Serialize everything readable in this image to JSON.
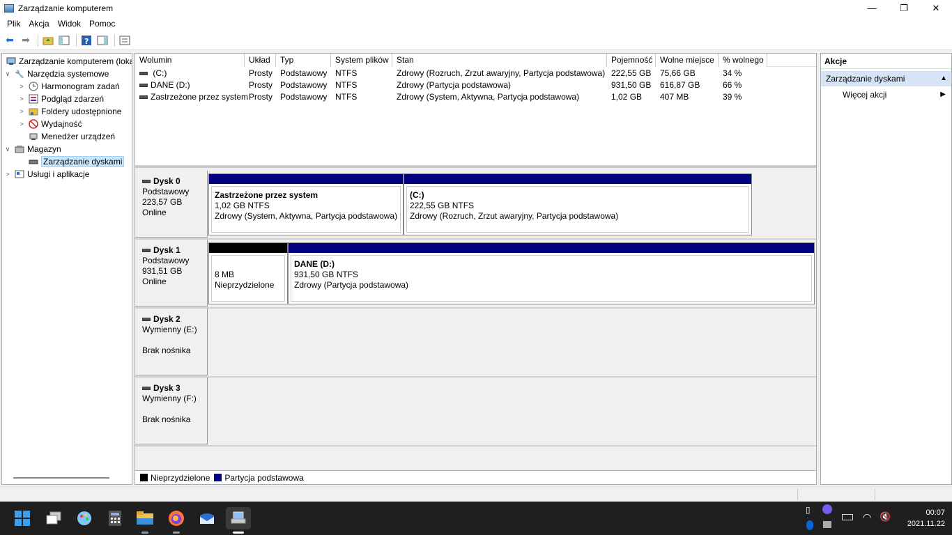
{
  "window": {
    "title": "Zarządzanie komputerem",
    "minimize": "—",
    "maximize": "❐",
    "close": "✕"
  },
  "menu": [
    "Plik",
    "Akcja",
    "Widok",
    "Pomoc"
  ],
  "tree": {
    "root": "Zarządzanie komputerem (loka",
    "tools": "Narzędzia systemowe",
    "scheduler": "Harmonogram zadań",
    "eventviewer": "Podgląd zdarzeń",
    "shared": "Foldery udostępnione",
    "performance": "Wydajność",
    "devmgr": "Menedżer urządzeń",
    "storage": "Magazyn",
    "diskmgmt": "Zarządzanie dyskami",
    "services": "Usługi i aplikacje"
  },
  "volumes": {
    "headers": [
      "Wolumin",
      "Układ",
      "Typ",
      "System plików",
      "Stan",
      "Pojemność",
      "Wolne miejsce",
      "% wolnego"
    ],
    "rows": [
      [
        "(C:)",
        "Prosty",
        "Podstawowy",
        "NTFS",
        "Zdrowy (Rozruch, Zrzut awaryjny, Partycja podstawowa)",
        "222,55 GB",
        "75,66 GB",
        "34 %"
      ],
      [
        "DANE (D:)",
        "Prosty",
        "Podstawowy",
        "NTFS",
        "Zdrowy (Partycja podstawowa)",
        "931,50 GB",
        "616,87 GB",
        "66 %"
      ],
      [
        "Zastrzeżone przez system",
        "Prosty",
        "Podstawowy",
        "NTFS",
        "Zdrowy (System, Aktywna, Partycja podstawowa)",
        "1,02 GB",
        "407 MB",
        "39 %"
      ]
    ]
  },
  "disks": [
    {
      "name": "Dysk 0",
      "l1": "Podstawowy",
      "l2": "223,57 GB",
      "l3": "Online",
      "parts": [
        {
          "name": "Zastrzeżone przez system",
          "size": "1,02 GB NTFS",
          "status": "Zdrowy (System, Aktywna, Partycja podstawowa)"
        },
        {
          "name": "(C:)",
          "size": "222,55 GB NTFS",
          "status": "Zdrowy (Rozruch, Zrzut awaryjny, Partycja podstawowa)"
        }
      ]
    },
    {
      "name": "Dysk 1",
      "l1": "Podstawowy",
      "l2": "931,51 GB",
      "l3": "Online",
      "parts": [
        {
          "name": "",
          "size": "8 MB",
          "status": "Nieprzydzielone"
        },
        {
          "name": "DANE  (D:)",
          "size": "931,50 GB NTFS",
          "status": "Zdrowy (Partycja podstawowa)"
        }
      ]
    },
    {
      "name": "Dysk 2",
      "l1": "Wymienny (E:)",
      "l2": "",
      "l3": "Brak nośnika"
    },
    {
      "name": "Dysk 3",
      "l1": "Wymienny (F:)",
      "l2": "",
      "l3": "Brak nośnika"
    }
  ],
  "legend": {
    "unallocated": "Nieprzydzielone",
    "primary": "Partycja podstawowa"
  },
  "colors": {
    "primary": "#000080",
    "unallocated": "#000000",
    "selection": "#cce8ff",
    "taskbar": "#1f1f1f"
  },
  "actions": {
    "header": "Akcje",
    "section": "Zarządzanie dyskami",
    "more": "Więcej akcji"
  },
  "clock": {
    "time": "00:07",
    "date": "2021.11.22"
  }
}
